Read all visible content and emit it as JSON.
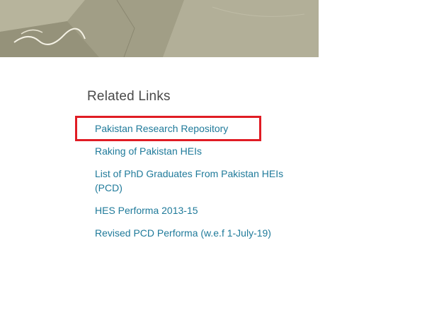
{
  "related_links": {
    "title": "Related Links",
    "items": [
      {
        "label": "Pakistan Research Repository"
      },
      {
        "label": "Raking of Pakistan HEIs"
      },
      {
        "label": "List of PhD Graduates From Pakistan HEIs (PCD)"
      },
      {
        "label": "HES Performa 2013-15"
      },
      {
        "label": "Revised PCD Performa (w.e.f 1-July-19)"
      }
    ]
  },
  "colors": {
    "link": "#1f7a9a",
    "heading": "#4a4a4a",
    "highlight": "#e01c24",
    "banner": "#a9a68e"
  }
}
